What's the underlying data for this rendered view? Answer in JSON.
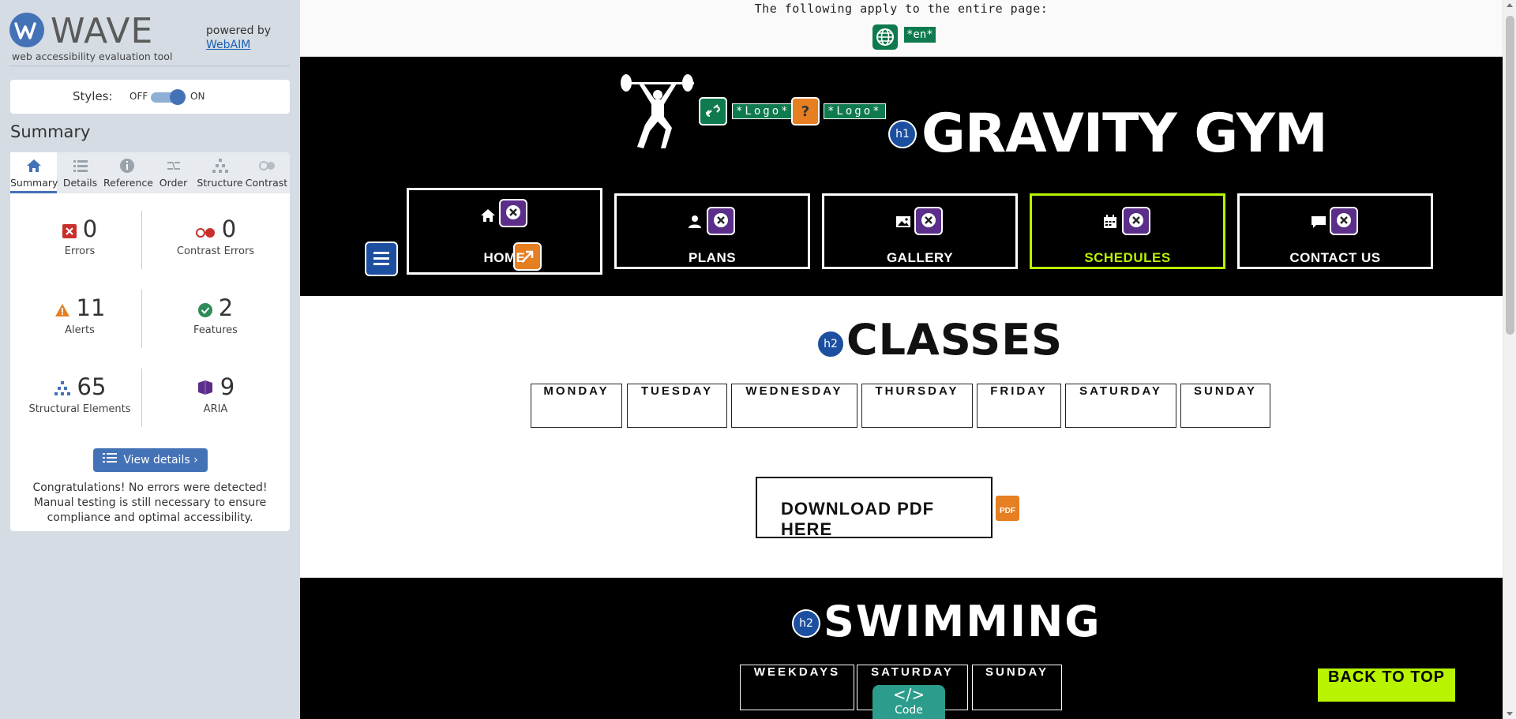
{
  "wave": {
    "brand": "WAVE",
    "tagline": "web accessibility evaluation tool",
    "powered_by": "powered by",
    "powered_link": "WebAIM",
    "styles_label": "Styles:",
    "styles_off": "OFF",
    "styles_on": "ON",
    "summary_title": "Summary",
    "tabs": [
      {
        "label": "Summary",
        "icon": "home-icon"
      },
      {
        "label": "Details",
        "icon": "list-icon"
      },
      {
        "label": "Reference",
        "icon": "info-icon"
      },
      {
        "label": "Order",
        "icon": "order-icon"
      },
      {
        "label": "Structure",
        "icon": "structure-icon"
      },
      {
        "label": "Contrast",
        "icon": "contrast-icon"
      }
    ],
    "stats": {
      "errors": {
        "value": "0",
        "label": "Errors"
      },
      "contrast": {
        "value": "0",
        "label": "Contrast Errors"
      },
      "alerts": {
        "value": "11",
        "label": "Alerts"
      },
      "features": {
        "value": "2",
        "label": "Features"
      },
      "structural": {
        "value": "65",
        "label": "Structural Elements"
      },
      "aria": {
        "value": "9",
        "label": "ARIA"
      }
    },
    "details_button": "View details ›",
    "congrats": "Congratulations! No errors were detected! Manual testing is still necessary to ensure compliance and optimal accessibility."
  },
  "page": {
    "apply_text": "The following apply to the entire page:",
    "lang_tag": "*en*",
    "logo_alt_1": "*Logo*",
    "logo_alt_2": "*Logo*",
    "h1_badge": "h1",
    "title": "GRAVITY GYM",
    "nav": [
      {
        "label": "HOME",
        "icon": "home-icon"
      },
      {
        "label": "PLANS",
        "icon": "user-icon"
      },
      {
        "label": "GALLERY",
        "icon": "image-icon"
      },
      {
        "label": "SCHEDULES",
        "icon": "calendar-icon"
      },
      {
        "label": "CONTACT US",
        "icon": "chat-icon"
      }
    ],
    "h2_badge": "h2",
    "classes_heading": "CLASSES",
    "days": [
      "MONDAY",
      "TUESDAY",
      "WEDNESDAY",
      "THURSDAY",
      "FRIDAY",
      "SATURDAY",
      "SUNDAY"
    ],
    "pdf_button": "DOWNLOAD PDF HERE",
    "pdf_badge_text": "PDF",
    "swimming_heading": "SWIMMING",
    "swim_days": [
      "WEEKDAYS",
      "SATURDAY",
      "SUNDAY"
    ],
    "code_glyph": "</>",
    "code_label": "Code",
    "back_to_top": "BACK TO TOP"
  },
  "colors": {
    "wave_blue": "#4472b7",
    "feature_green": "#0e7a4e",
    "alert_orange": "#e67e22",
    "aria_purple": "#5b2e8a",
    "accent_lime": "#b8f400"
  }
}
